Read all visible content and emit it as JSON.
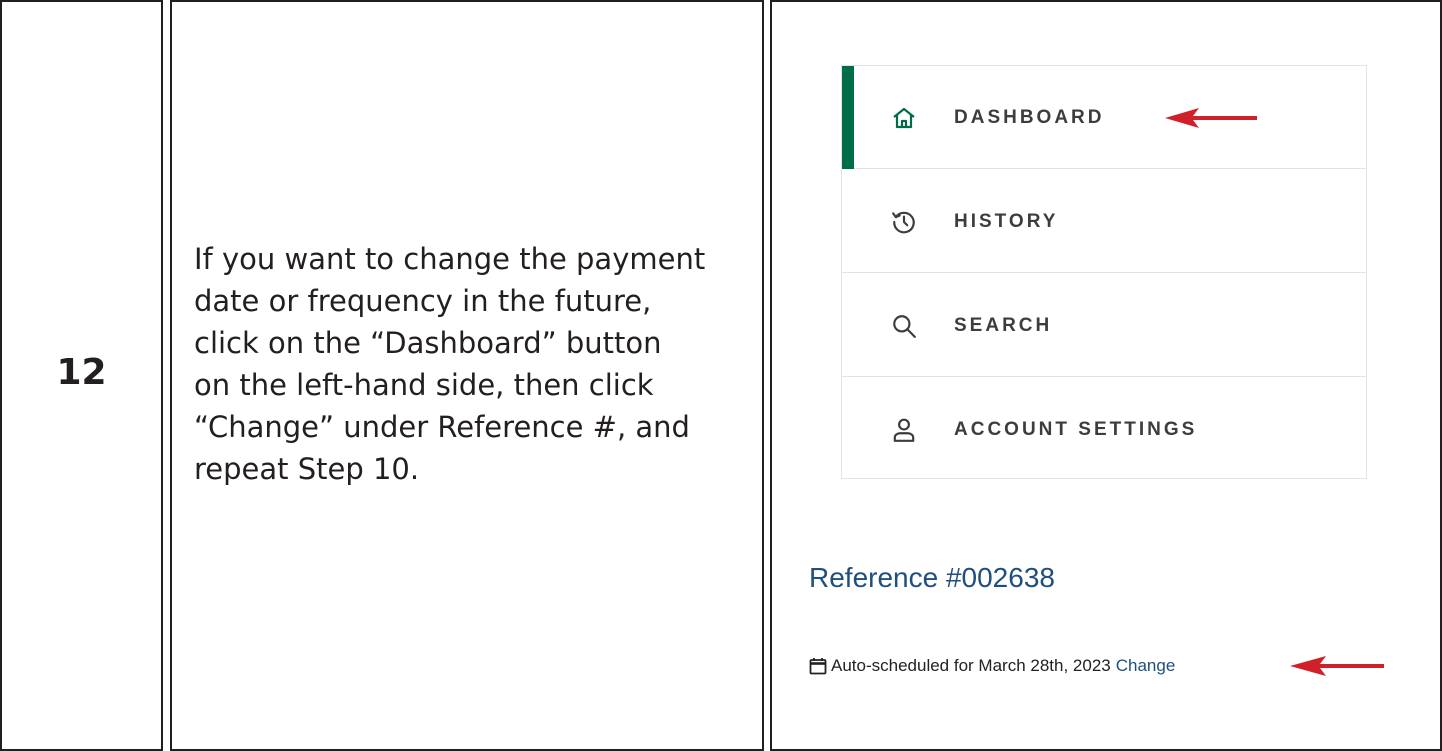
{
  "step": {
    "number": "12",
    "instruction_lines": [
      "If you want to change the payment",
      "date or frequency in the future,",
      "click on the “Dashboard” button",
      "on the left-hand side, then click",
      "“Change” under Reference #, and",
      "repeat Step 10."
    ]
  },
  "nav": {
    "items": [
      {
        "label": "DASHBOARD",
        "icon": "home-icon",
        "active": true
      },
      {
        "label": "HISTORY",
        "icon": "history-icon",
        "active": false
      },
      {
        "label": "SEARCH",
        "icon": "search-icon",
        "active": false
      },
      {
        "label": "ACCOUNT SETTINGS",
        "icon": "user-icon",
        "active": false
      }
    ]
  },
  "reference": {
    "title": "Reference #002638",
    "schedule_text": "Auto-scheduled for March 28th, 2023",
    "change_label": "Change"
  },
  "colors": {
    "active_accent": "#006c4a",
    "link": "#1f4f7d",
    "arrow": "#d0202a"
  }
}
